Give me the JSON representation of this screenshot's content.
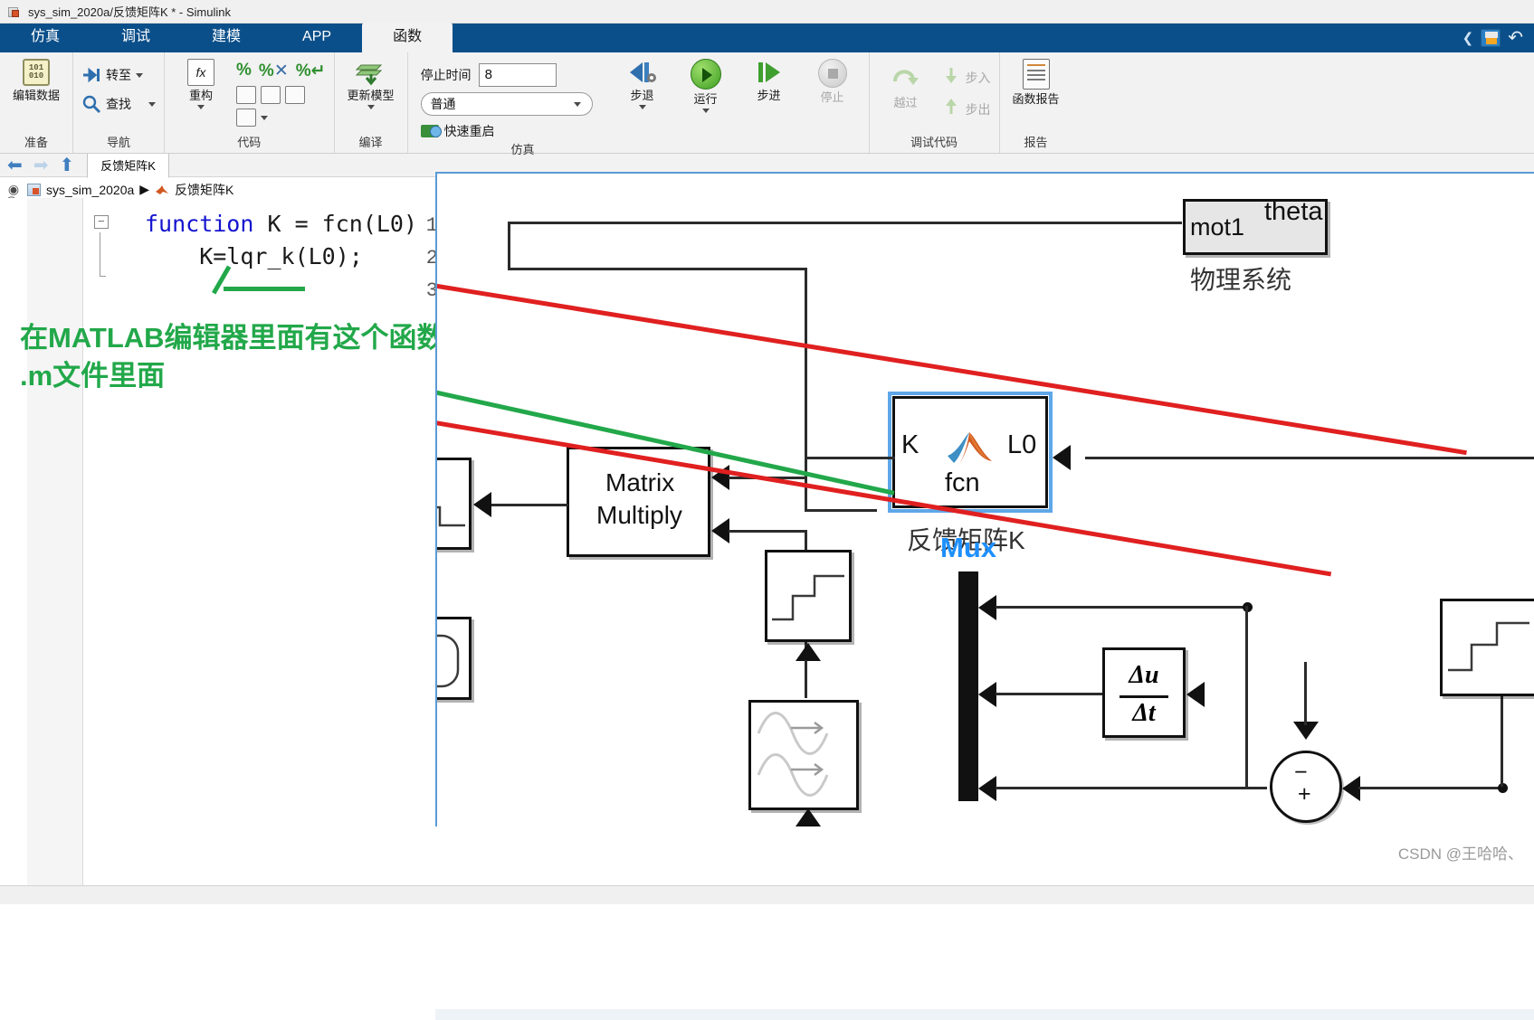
{
  "window": {
    "title": "sys_sim_2020a/反馈矩阵K * - Simulink",
    "app_icon": "simulink-file-icon"
  },
  "ribbon": {
    "tabs": [
      {
        "label": "仿真",
        "active": false
      },
      {
        "label": "调试",
        "active": false
      },
      {
        "label": "建模",
        "active": false
      },
      {
        "label": "APP",
        "active": false
      },
      {
        "label": "函数",
        "active": true
      }
    ],
    "quick_access": {
      "save_icon": "save-icon",
      "undo_icon": "undo-icon",
      "collapse_icon": "chevron-left-icon"
    },
    "groups": [
      {
        "label": "准备",
        "buttons": [
          {
            "label": "编辑数据",
            "icon": "edit-data-icon",
            "enabled": true
          }
        ]
      },
      {
        "label": "导航",
        "buttons": [
          {
            "label": "转至",
            "icon": "goto-icon",
            "enabled": true
          },
          {
            "label": "查找",
            "icon": "search-icon",
            "enabled": true
          }
        ]
      },
      {
        "label": "代码",
        "buttons": [
          {
            "label": "重构",
            "icon": "refactor-fx-icon",
            "enabled": true
          }
        ]
      },
      {
        "label": "编译",
        "buttons": [
          {
            "label": "更新模型",
            "icon": "update-model-icon",
            "enabled": true
          }
        ]
      },
      {
        "label": "仿真",
        "stop_time_label": "停止时间",
        "stop_time_value": "8",
        "mode_value": "普通",
        "fast_restart_label": "快速重启",
        "buttons": [
          {
            "label": "步退",
            "icon": "step-back-icon",
            "enabled": true
          },
          {
            "label": "运行",
            "icon": "run-icon",
            "enabled": true
          },
          {
            "label": "步进",
            "icon": "step-forward-icon",
            "enabled": true
          },
          {
            "label": "停止",
            "icon": "stop-icon",
            "enabled": false
          }
        ]
      },
      {
        "label": "调试代码",
        "buttons": [
          {
            "label": "越过",
            "icon": "step-over-icon",
            "enabled": false
          },
          {
            "label": "步入",
            "icon": "step-into-icon",
            "enabled": false
          },
          {
            "label": "步出",
            "icon": "step-out-icon",
            "enabled": false
          }
        ]
      },
      {
        "label": "报告",
        "buttons": [
          {
            "label": "函数报告",
            "icon": "function-report-icon",
            "enabled": true
          }
        ]
      }
    ]
  },
  "nav": {
    "back_icon": "arrow-left-icon",
    "forward_icon": "arrow-right-icon",
    "up_icon": "arrow-up-icon",
    "file_tab": "反馈矩阵K",
    "breadcrumb": [
      {
        "label": "sys_sim_2020a",
        "icon": "simulink-model-icon"
      },
      {
        "label": "反馈矩阵K",
        "icon": "matlab-fcn-icon"
      }
    ],
    "separator": "▶",
    "explore_icon": "explore-bar-icon",
    "expand_icon": "expand-chevrons-icon"
  },
  "editor": {
    "lines": [
      {
        "number": "1",
        "text": "function K = fcn(L0)",
        "keyword": "function",
        "rest": " K = fcn(L0)"
      },
      {
        "number": "2",
        "text": "    K=lqr_k(L0);"
      },
      {
        "number": "3",
        "text": ""
      }
    ],
    "fold_marker": "-"
  },
  "annotation": {
    "line1": "在MATLAB编辑器里面有这个函数",
    "line2": ".m文件里面",
    "color": "#22a84a"
  },
  "canvas": {
    "blocks": [
      {
        "name": "feedback-matrix-k-block",
        "caption": "反馈矩阵K",
        "inner_label": "fcn",
        "icon": "matlab-membrane-icon",
        "ports": [
          {
            "label": "K",
            "side": "left",
            "type": "output"
          },
          {
            "label": "L0",
            "side": "right",
            "type": "input"
          }
        ],
        "selected": true
      },
      {
        "name": "matrix-multiply-block",
        "label_line1": "Matrix",
        "label_line2": "Multiply",
        "selected": false
      },
      {
        "name": "physical-system-subsystem",
        "caption": "物理系统",
        "ports": [
          {
            "label": "mot1",
            "side": "left",
            "type": "input"
          },
          {
            "label": "theta",
            "side": "right",
            "type": "output"
          }
        ],
        "selected": false
      },
      {
        "name": "mux-block",
        "label": "Mux",
        "label_color": "#1e90ff"
      },
      {
        "name": "derivative-block",
        "numerator": "Δu",
        "denominator": "Δt"
      },
      {
        "name": "sum-block",
        "sign_minus": "−",
        "sign_plus": "+"
      },
      {
        "name": "step-block-upper",
        "icon": "step-signal-icon"
      },
      {
        "name": "step-block-lower",
        "icon": "step-signal-icon"
      },
      {
        "name": "step-block-mid",
        "icon": "step-signal-icon"
      },
      {
        "name": "sine-block",
        "icon": "sine-wave-icon"
      },
      {
        "name": "rounded-block",
        "icon": "rounded-rect-icon"
      }
    ],
    "annotation_lines": [
      {
        "name": "red-callout-line-1",
        "color": "#e02020"
      },
      {
        "name": "red-callout-line-2",
        "color": "#e02020"
      },
      {
        "name": "green-callout-line",
        "color": "#22a84a"
      }
    ]
  },
  "watermark": {
    "text": "CSDN @王哈哈、"
  }
}
